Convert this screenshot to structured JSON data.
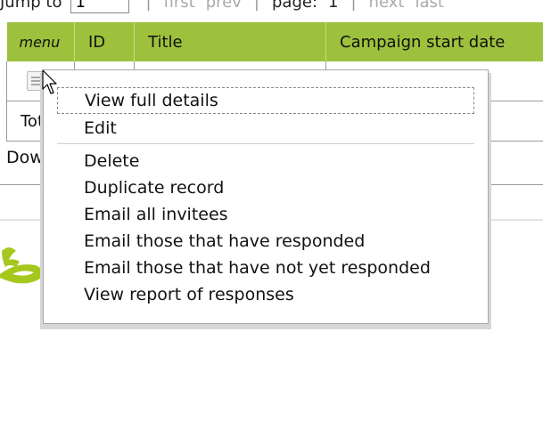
{
  "pager": {
    "jump_label": "Jump to",
    "jump_value": "1",
    "first": "first",
    "prev": "prev",
    "page_label": "page:",
    "page_number": "1",
    "next": "next",
    "last": "last"
  },
  "table": {
    "headers": [
      "menu",
      "ID",
      "Title",
      "Campaign start date"
    ],
    "total_label": "Tot"
  },
  "download_label": "Dow",
  "context_menu": {
    "items": [
      "View full details",
      "Edit",
      "Delete",
      "Duplicate record",
      "Email all invitees",
      "Email those that have responded",
      "Email those that have not yet responded",
      "View report of responses"
    ]
  },
  "colors": {
    "header_bg": "#9dc13c",
    "logo": "#a6c81e"
  }
}
